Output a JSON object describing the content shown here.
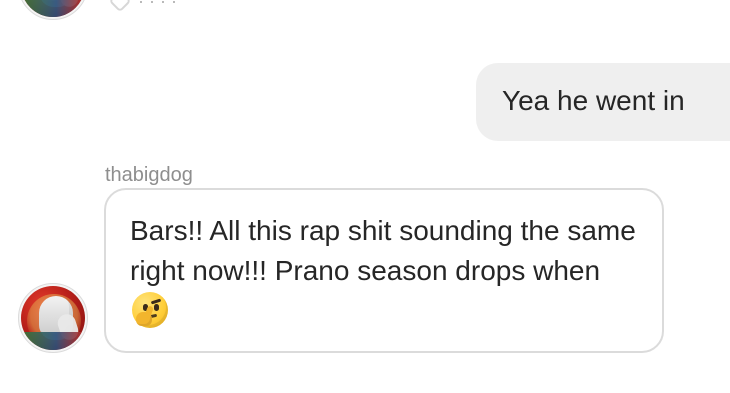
{
  "top_clipped": {
    "meta_text": "·  ·  ·  ·"
  },
  "messages": {
    "outgoing": {
      "text": "Yea he went in"
    },
    "incoming": {
      "sender": "thabigdog",
      "text": "Bars!! All this rap shit sounding the same right now!!! Prano season drops when",
      "emoji": "thinking-face"
    }
  },
  "colors": {
    "background": "#ffffff",
    "outgoing_bubble": "#efefef",
    "incoming_border": "#dbdbdb",
    "text": "#262626",
    "secondary_text": "#8e8e8e"
  },
  "icons": {
    "top_reaction_icon": "heart-outline-icon"
  }
}
